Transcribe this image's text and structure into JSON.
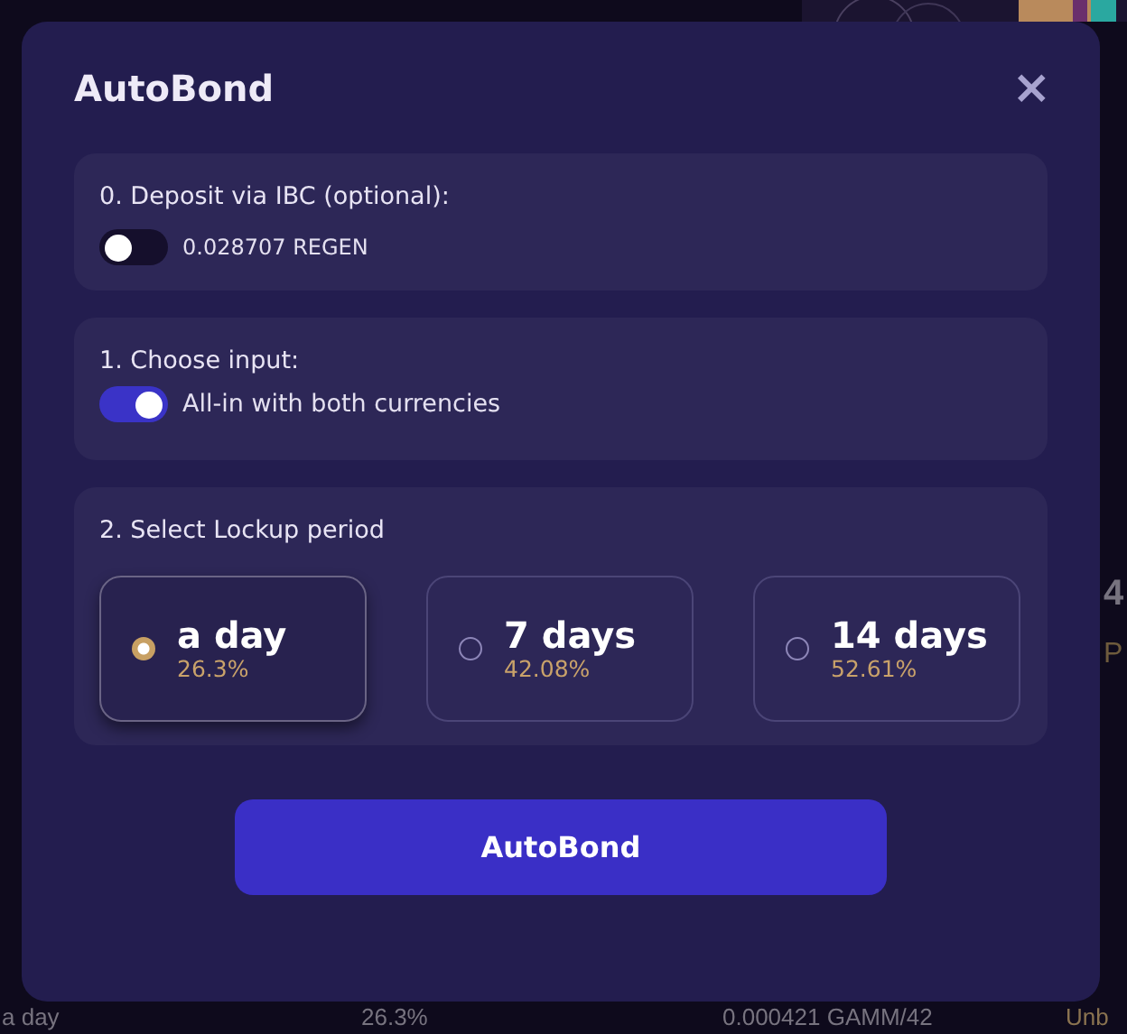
{
  "background": {
    "right_fragments": [
      "4",
      "P"
    ],
    "bottom_row": [
      "a day",
      "26.3%",
      "0.000421 GAMM/42",
      "Unb"
    ]
  },
  "modal": {
    "title": "AutoBond",
    "close": "×",
    "sections": [
      {
        "kind": "toggle",
        "heading": "0. Deposit via IBC (optional):",
        "on": false,
        "label": "0.028707 REGEN"
      },
      {
        "kind": "toggle",
        "heading": "1. Choose input:",
        "on": true,
        "label": "All-in with both currencies"
      },
      {
        "kind": "options",
        "heading": "2. Select Lockup period",
        "options": [
          {
            "label": "a day",
            "apr": "26.3%",
            "selected": true
          },
          {
            "label": "7 days",
            "apr": "42.08%",
            "selected": false
          },
          {
            "label": "14 days",
            "apr": "52.61%",
            "selected": false
          }
        ]
      }
    ],
    "button": "AutoBond"
  }
}
